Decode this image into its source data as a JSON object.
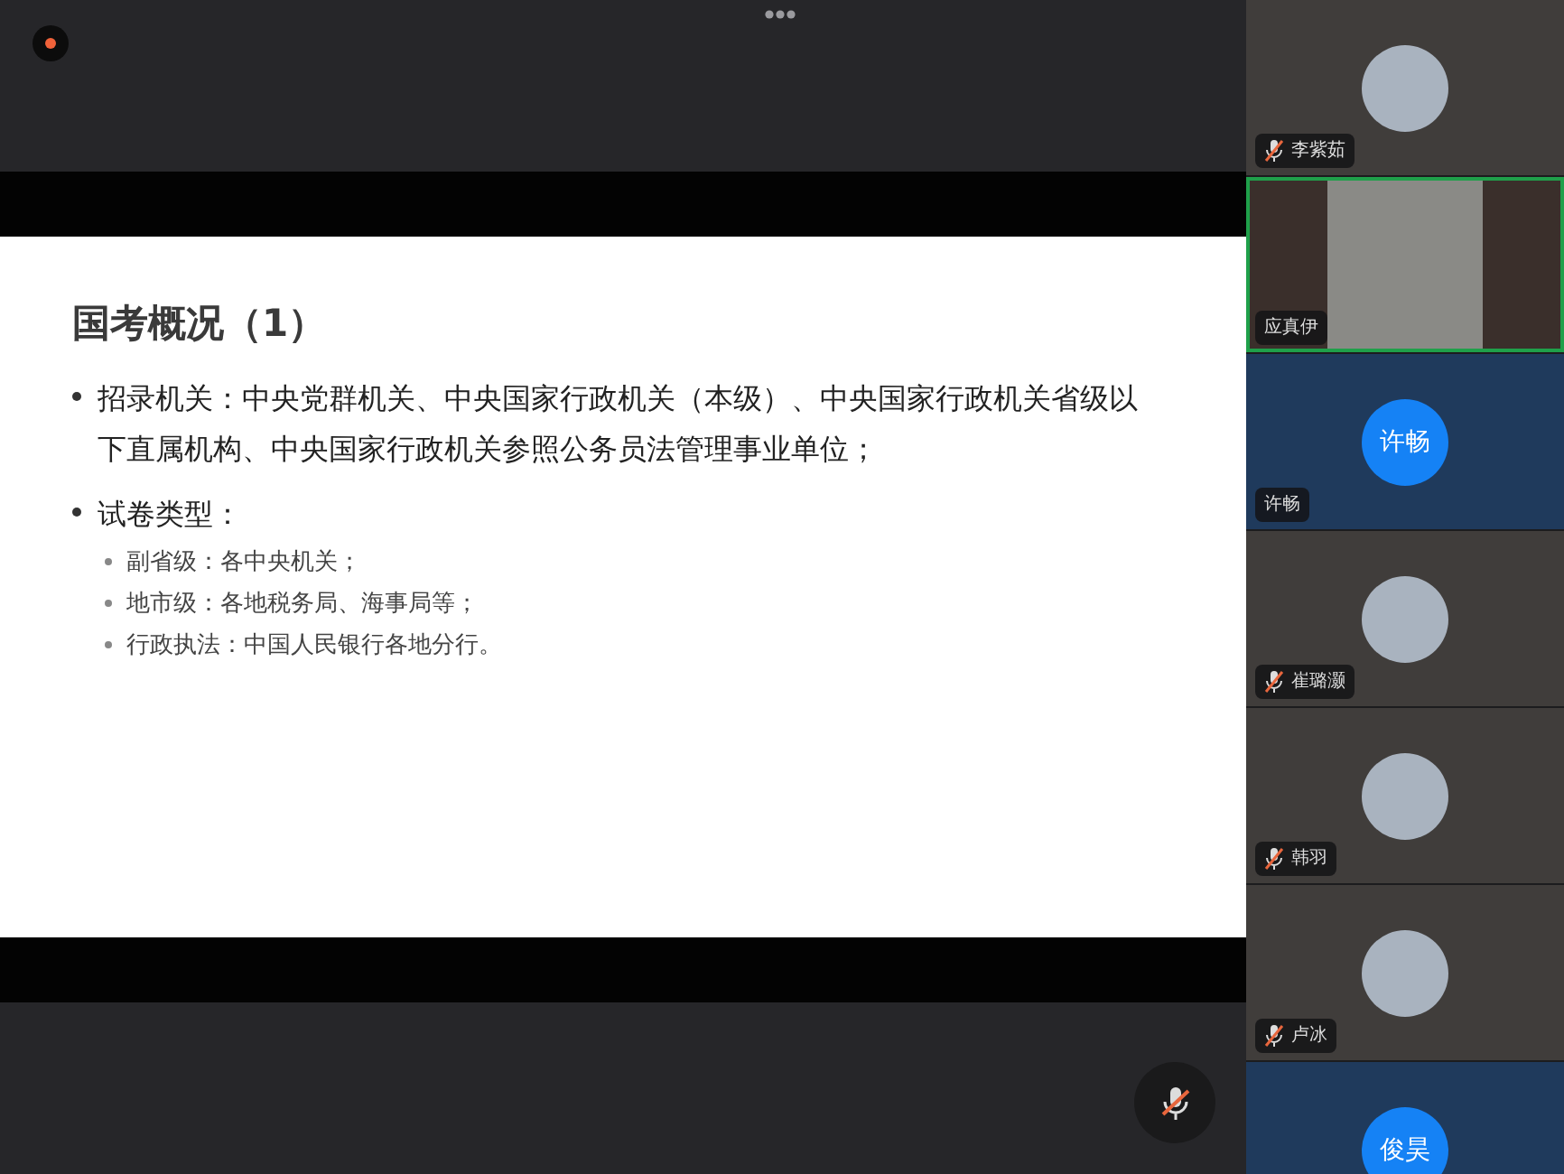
{
  "slide": {
    "title": "国考概况（1）",
    "bullets": [
      {
        "text": "招录机关：中央党群机关、中央国家行政机关（本级）、中央国家行政机关省级以下直属机构、中央国家行政机关参照公务员法管理事业单位；"
      },
      {
        "text": "试卷类型：",
        "children": [
          {
            "text": "副省级：各中央机关；"
          },
          {
            "text": "地市级：各地税务局、海事局等；"
          },
          {
            "text": "行政执法：中国人民银行各地分行。"
          }
        ]
      }
    ]
  },
  "recording": true,
  "mic_muted": true,
  "participants": [
    {
      "kind": "photo",
      "name": "李紫茹",
      "muted": true,
      "selected": false
    },
    {
      "kind": "video",
      "name": "应真伊",
      "muted": false,
      "selected": true
    },
    {
      "kind": "initials",
      "initials": "许畅",
      "name": "许畅",
      "muted": false,
      "selected": false
    },
    {
      "kind": "photo",
      "name": "崔璐灏",
      "muted": true,
      "selected": false
    },
    {
      "kind": "photo",
      "name": "韩羽",
      "muted": true,
      "selected": false
    },
    {
      "kind": "photo",
      "name": "卢冰",
      "muted": true,
      "selected": false
    },
    {
      "kind": "initials",
      "initials": "俊昊",
      "selected": false
    }
  ]
}
